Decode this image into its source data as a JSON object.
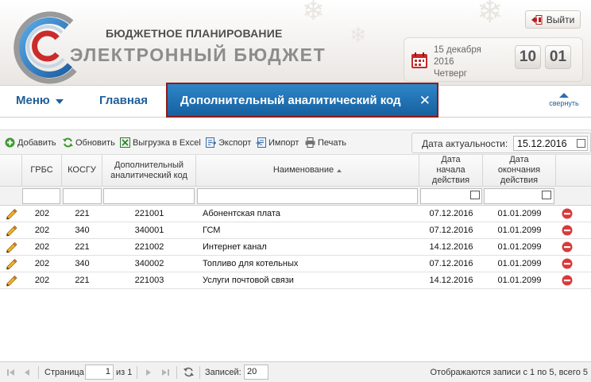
{
  "header": {
    "brand_sub": "БЮДЖЕТНОЕ ПЛАНИРОВАНИЕ",
    "brand_main": "ЭЛЕКТРОННЫЙ БЮДЖЕТ",
    "logout_label": "Выйти",
    "date_line1": "15 декабря",
    "date_line2": "2016",
    "date_line3": "Четверг",
    "clock_hours": "10",
    "clock_minutes": "01"
  },
  "nav": {
    "menu_label": "Меню",
    "home_label": "Главная",
    "active_tab_label": "Дополнительный аналитический код",
    "close_glyph": "✕",
    "collapse_label": "свернуть"
  },
  "toolbar": {
    "add_label": "Добавить",
    "refresh_label": "Обновить",
    "excel_label": "Выгрузка в Excel",
    "export_label": "Экспорт",
    "import_label": "Импорт",
    "print_label": "Печать",
    "asof_label": "Дата актуальности:",
    "asof_value": "15.12.2016"
  },
  "grid": {
    "columns": {
      "grbs": "ГРБС",
      "kosgu": "КОСГУ",
      "code": "Дополнительный аналитический код",
      "name": "Наименование",
      "start": "Дата начала действия",
      "end": "Дата окончания действия"
    },
    "rows": [
      {
        "grbs": "202",
        "kosgu": "221",
        "code": "221001",
        "name": "Абонентская плата",
        "start": "07.12.2016",
        "end": "01.01.2099"
      },
      {
        "grbs": "202",
        "kosgu": "340",
        "code": "340001",
        "name": "ГСМ",
        "start": "07.12.2016",
        "end": "01.01.2099"
      },
      {
        "grbs": "202",
        "kosgu": "221",
        "code": "221002",
        "name": "Интернет канал",
        "start": "14.12.2016",
        "end": "01.01.2099"
      },
      {
        "grbs": "202",
        "kosgu": "340",
        "code": "340002",
        "name": "Топливо для котельных",
        "start": "07.12.2016",
        "end": "01.01.2099"
      },
      {
        "grbs": "202",
        "kosgu": "221",
        "code": "221003",
        "name": "Услуги почтовой связи",
        "start": "14.12.2016",
        "end": "01.01.2099"
      }
    ]
  },
  "pager": {
    "page_label": "Страница",
    "page_value": "1",
    "of_label": "из 1",
    "records_label": "Записей:",
    "records_value": "20",
    "summary": "Отображаются записи с 1 по 5, всего 5"
  },
  "colors": {
    "brand_blue": "#1f5f99",
    "tab_blue": "#1f74b8",
    "tab_border": "#8f1a1a",
    "delete_red": "#d93a3a"
  }
}
